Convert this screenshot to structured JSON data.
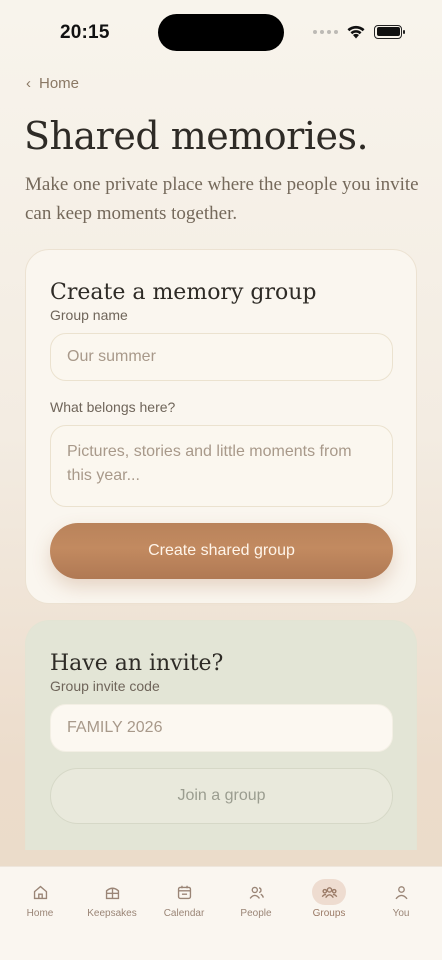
{
  "status": {
    "time": "20:15"
  },
  "nav": {
    "back_label": "Home"
  },
  "header": {
    "title": "Shared memories.",
    "subtitle": "Make one private place where the people you invite can keep moments together."
  },
  "create_card": {
    "title": "Create a memory group",
    "name_label": "Group name",
    "name_placeholder": "Our summer",
    "desc_label": "What belongs here?",
    "desc_placeholder": "Pictures, stories and little moments from this year...",
    "button_label": "Create shared group"
  },
  "join_card": {
    "title": "Have an invite?",
    "code_label": "Group invite code",
    "code_placeholder": "FAMILY 2026",
    "button_label": "Join a group"
  },
  "tabs": [
    {
      "label": "Home",
      "icon": "house-icon"
    },
    {
      "label": "Keepsakes",
      "icon": "box-icon"
    },
    {
      "label": "Calendar",
      "icon": "calendar-icon"
    },
    {
      "label": "People",
      "icon": "people-icon"
    },
    {
      "label": "Groups",
      "icon": "group-icon",
      "active": true
    },
    {
      "label": "You",
      "icon": "person-icon"
    }
  ],
  "colors": {
    "accent": "#b9835b",
    "join_card_bg": "#e3e5d6",
    "active_tab_bg": "#eedcd0"
  }
}
